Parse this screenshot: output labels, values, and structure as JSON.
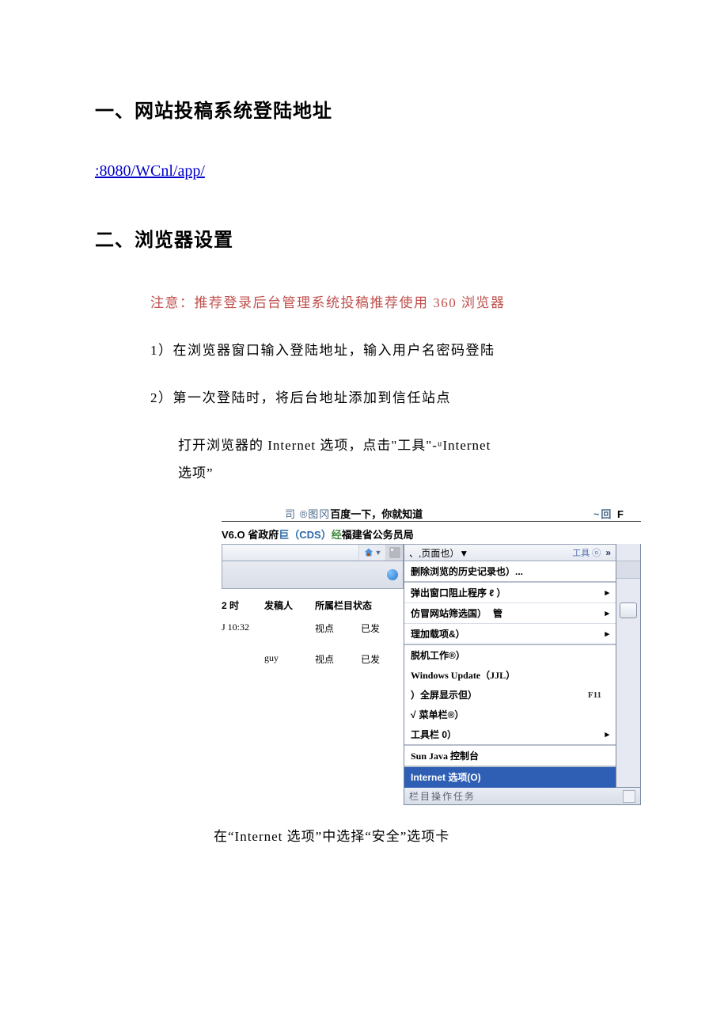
{
  "section1": {
    "heading": "一、网站投稿系统登陆地址",
    "link": ":8080/WCnl/app/"
  },
  "section2": {
    "heading": "二、浏览器设置",
    "notice": "注意：推荐登录后台管理系统投稿推荐使用 360 浏览器",
    "step1": "1）在浏览器窗口输入登陆地址，输入用户名密码登陆",
    "step2": "2）第一次登陆时，将后台地址添加到信任站点",
    "step3": "打开浏览器的 Internet 选项，点击\"工具\"-ᵘInternet",
    "step3b": "选项”",
    "after_figure": "在“Internet 选项”中选择“安全”选项卡"
  },
  "screenshot": {
    "title_prefix": "司 ®图冈",
    "title_main": "百度一下，你就知道",
    "title_right_a": "~回",
    "title_right_b": "F",
    "bookmarks_pre": "V6.O 省政府",
    "bookmarks_b": "巨（CDS）",
    "bookmarks_g": "经",
    "bookmarks_post": "福建省公务员局",
    "table": {
      "headers": {
        "col1": "2 时",
        "col2": "发稿人",
        "col3": "所属栏目状态"
      },
      "rows": [
        {
          "time": "J 10:32",
          "author": "",
          "col": "视点",
          "state": "已发"
        },
        {
          "time": "",
          "author": "guy",
          "col": "视点",
          "state": "已发"
        }
      ]
    },
    "menu": {
      "top_strip": "、,页面也）▼",
      "tool_badge": "工具 ⓞ",
      "items": {
        "delete_history": "删除浏览的历史记录也）...",
        "popup": "弹出窗口阻止程序 ℓ ）",
        "phishing": "仿冒网站筛选国）",
        "addons_a": "管",
        "addons_b": "理加载项&）",
        "offline": "脱机工作®）",
        "win_update": "Windows Update（JJL）",
        "fullscreen": "）全屏显示但）",
        "menubar": "菜单栏®）",
        "toolbar": "工具栏 0）",
        "sunjava": "Sun Java 控制台",
        "internet_options": "Internet 选项(O)",
        "shortcut_f11": "F11"
      }
    },
    "bottom_strip": "栏目操作任务"
  }
}
